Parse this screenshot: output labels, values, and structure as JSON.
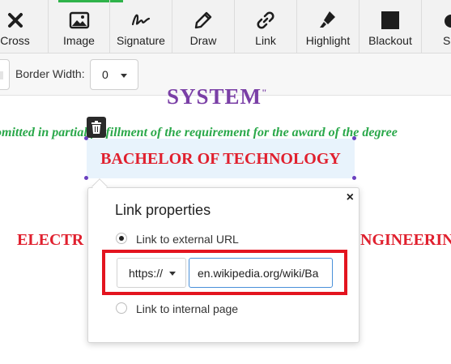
{
  "toolbar": {
    "items": [
      {
        "label": "Cross",
        "icon": "cross-icon"
      },
      {
        "label": "Image",
        "icon": "image-icon"
      },
      {
        "label": "Signature",
        "icon": "signature-icon"
      },
      {
        "label": "Draw",
        "icon": "pencil-icon"
      },
      {
        "label": "Link",
        "icon": "link-icon"
      },
      {
        "label": "Highlight",
        "icon": "highlighter-icon"
      },
      {
        "label": "Blackout",
        "icon": "blackout-icon"
      },
      {
        "label": "Sha",
        "icon": "shape-icon"
      }
    ],
    "active_color": "#2fb34a"
  },
  "properties": {
    "border_width_label": "Border Width:",
    "border_width_value": "0"
  },
  "document": {
    "title": "SYSTEM",
    "title_mark": "\"",
    "submitted_text": "omitted in partial fulfillment of the requirement for the award of the degree",
    "degree": "BACHELOR OF TECHNOLOGY",
    "dept_left": "ELECTR",
    "dept_right": "NGINEERIN",
    "colors": {
      "title": "#7a3fa6",
      "submitted": "#2aa84a",
      "degree": "#e0202e"
    }
  },
  "link_popup": {
    "title": "Link properties",
    "close": "×",
    "option_external": "Link to external URL",
    "option_internal": "Link to internal page",
    "selected_option": "external",
    "protocol_value": "https://",
    "url_value": "en.wikipedia.org/wiki/Ba",
    "highlight_color": "#e3141f"
  }
}
